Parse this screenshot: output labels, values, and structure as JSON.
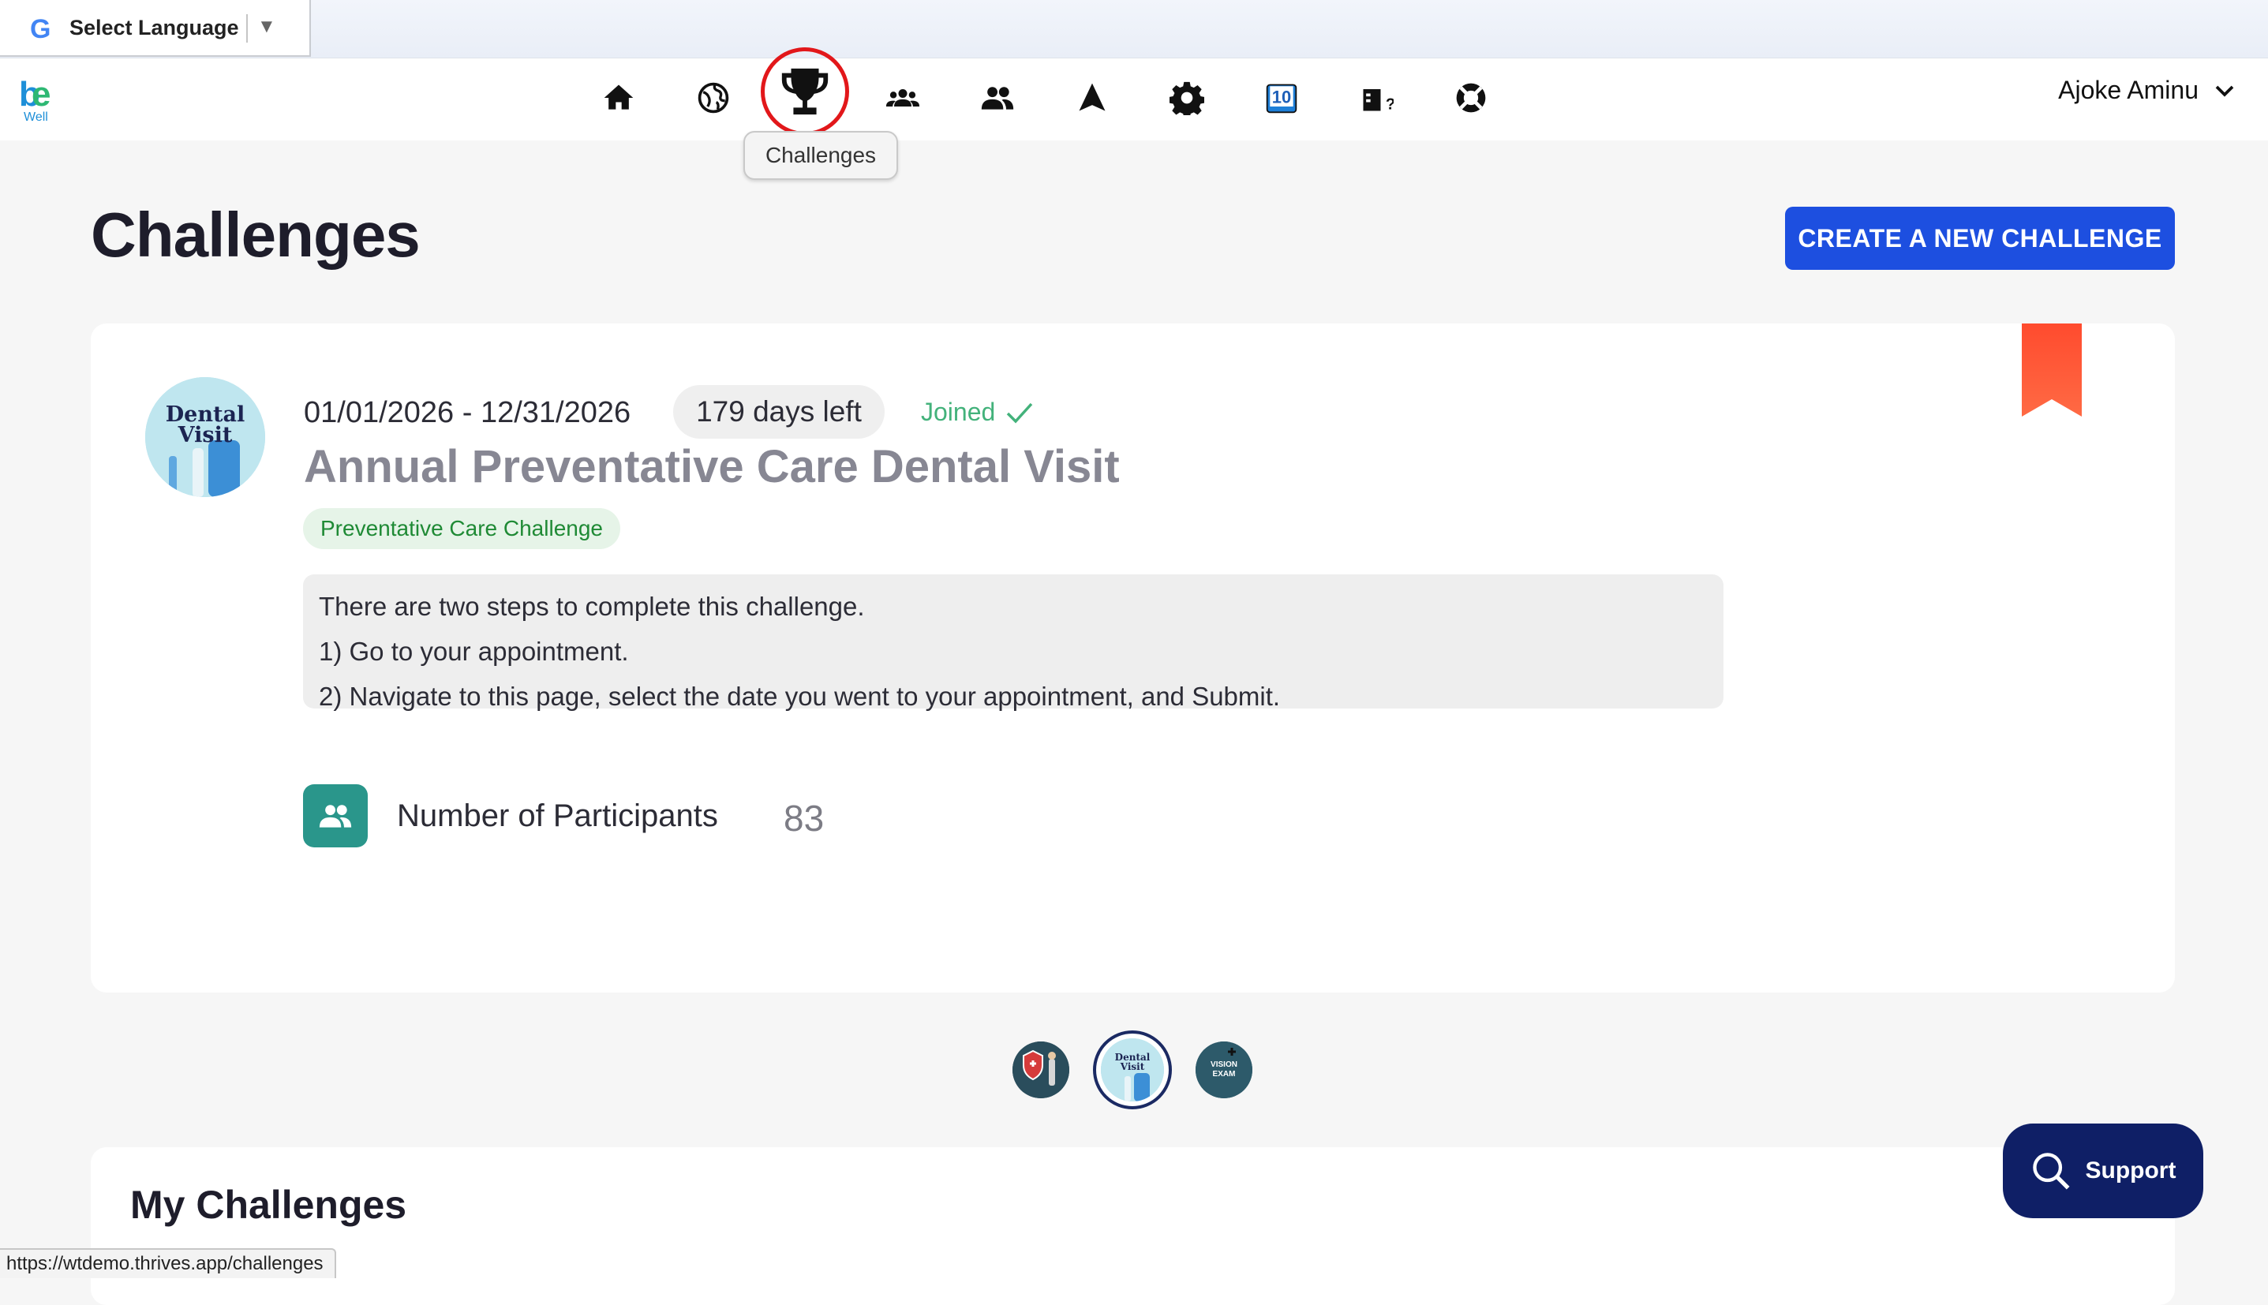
{
  "translate_bar": {
    "label": "Select Language",
    "arrow": "▼",
    "google_icon_letter": "G"
  },
  "nav": {
    "logo_letters_b": "b",
    "logo_letters_e": "e",
    "logo_sub": "Well",
    "icons": [
      "home-icon",
      "globe-icon",
      "trophy-icon",
      "groups-icon",
      "people-icon",
      "navigation-arrow-icon",
      "gear-icon",
      "calendar-10-icon",
      "quiz-icon",
      "lifebuoy-icon"
    ],
    "calendar_number": "10",
    "tooltip": "Challenges",
    "user_name": "Ajoke Aminu"
  },
  "header": {
    "title": "Challenges",
    "create_button": "CREATE A NEW CHALLENGE"
  },
  "challenge": {
    "dates": "01/01/2026 - 12/31/2026",
    "days_left": "179 days left",
    "status": "Joined",
    "title": "Annual Preventative Care Dental Visit",
    "tag": "Preventative Care Challenge",
    "description": [
      "There are two steps to complete this challenge.",
      "1) Go to your appointment.",
      "2) Navigate to this page, select the date you went to your appointment, and Submit."
    ],
    "avatar_text_1": "Dental",
    "avatar_text_2": "Visit",
    "participants_label": "Number of Participants",
    "participants_count": "83"
  },
  "carousel": {
    "dot3_text_1": "VISION",
    "dot3_text_2": "EXAM",
    "dot2_text_1": "Dental",
    "dot2_text_2": "Visit"
  },
  "my_challenges": {
    "title": "My Challenges"
  },
  "support": {
    "label": "Support"
  },
  "status_bar": {
    "url": "https://wtdemo.thrives.app/challenges"
  },
  "colors": {
    "accent_button": "#1d4fe0",
    "support_button": "#0f1f66",
    "joined_green": "#43b27b",
    "tag_green": "#1f8a35",
    "bookmark_orange": "#ff5a36",
    "participants_teal": "#2a968b",
    "highlight_circle": "#e2171a"
  }
}
